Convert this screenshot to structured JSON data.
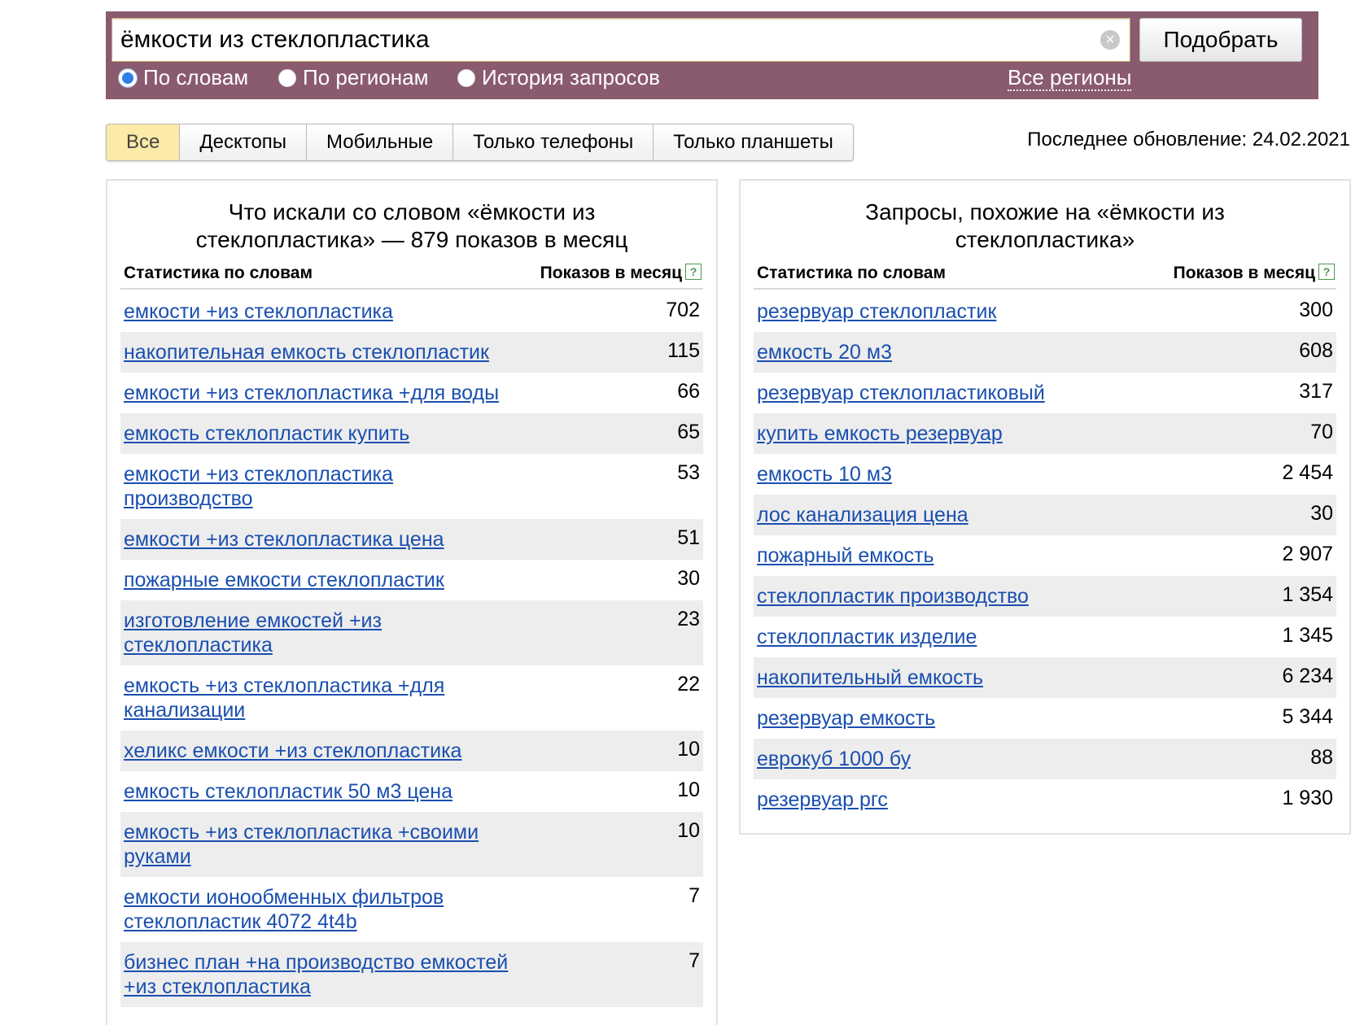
{
  "search": {
    "query": "ёмкости из стеклопластика",
    "submit_label": "Подобрать",
    "modes": [
      "По словам",
      "По регионам",
      "История запросов"
    ],
    "selected_mode": "По словам",
    "region_link": "Все регионы"
  },
  "device_tabs": [
    "Все",
    "Десктопы",
    "Мобильные",
    "Только телефоны",
    "Только планшеты"
  ],
  "active_device_tab": "Все",
  "last_update": "Последнее обновление: 24.02.2021",
  "left_panel": {
    "title": "Что искали со словом «ёмкости из стеклопластика» — 879 показов в месяц",
    "col_words": "Статистика по словам",
    "col_shows": "Показов в месяц",
    "rows": [
      {
        "phrase": "емкости +из стеклопластика",
        "count": "702"
      },
      {
        "phrase": "накопительная емкость стеклопластик",
        "count": "115"
      },
      {
        "phrase": "емкости +из стеклопластика +для воды",
        "count": "66"
      },
      {
        "phrase": "емкость стеклопластик купить",
        "count": "65"
      },
      {
        "phrase": "емкости +из стеклопластика производство",
        "count": "53"
      },
      {
        "phrase": "емкости +из стеклопластика цена",
        "count": "51"
      },
      {
        "phrase": "пожарные емкости стеклопластик",
        "count": "30"
      },
      {
        "phrase": "изготовление емкостей +из стеклопластика",
        "count": "23"
      },
      {
        "phrase": "емкость +из стеклопластика +для канализации",
        "count": "22"
      },
      {
        "phrase": "хеликс емкости +из стеклопластика",
        "count": "10"
      },
      {
        "phrase": "емкость стеклопластик 50 м3 цена",
        "count": "10"
      },
      {
        "phrase": "емкость +из стеклопластика +своими руками",
        "count": "10"
      },
      {
        "phrase": "емкости ионообменных фильтров стеклопластик 4072 4t4b",
        "count": "7"
      },
      {
        "phrase": "бизнес план +на производство емкостей +из стеклопластика",
        "count": "7"
      }
    ]
  },
  "right_panel": {
    "title": "Запросы, похожие на «ёмкости из стеклопластика»",
    "col_words": "Статистика по словам",
    "col_shows": "Показов в месяц",
    "rows": [
      {
        "phrase": "резервуар стеклопластик",
        "count": "300"
      },
      {
        "phrase": "емкость 20 м3",
        "count": "608"
      },
      {
        "phrase": "резервуар стеклопластиковый",
        "count": "317"
      },
      {
        "phrase": "купить емкость резервуар",
        "count": "70"
      },
      {
        "phrase": "емкость 10 м3",
        "count": "2 454"
      },
      {
        "phrase": "лос канализация цена",
        "count": "30"
      },
      {
        "phrase": "пожарный емкость",
        "count": "2 907"
      },
      {
        "phrase": "стеклопластик производство",
        "count": "1 354"
      },
      {
        "phrase": "стеклопластик изделие",
        "count": "1 345"
      },
      {
        "phrase": "накопительный емкость",
        "count": "6 234"
      },
      {
        "phrase": "резервуар емкость",
        "count": "5 344"
      },
      {
        "phrase": "еврокуб 1000 бу",
        "count": "88"
      },
      {
        "phrase": "резервуар ргс",
        "count": "1 930"
      }
    ]
  }
}
